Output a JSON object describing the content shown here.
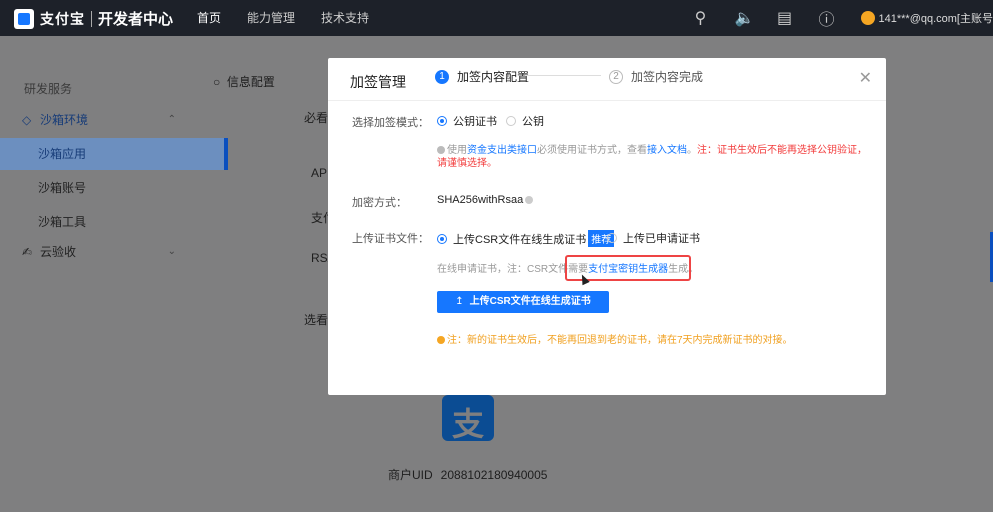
{
  "topbar": {
    "logo_brand": "支付宝",
    "logo_sub": "开发者中心",
    "nav": [
      "首页",
      "能力管理",
      "技术支持"
    ],
    "account": "141***@qq.com[主账号"
  },
  "sidebar": {
    "section": "研发服务",
    "items": [
      {
        "label": "沙箱环境",
        "icon": "cube-icon"
      },
      {
        "label": "沙箱应用"
      },
      {
        "label": "沙箱账号"
      },
      {
        "label": "沙箱工具"
      },
      {
        "label": "云验收",
        "icon": "check-doc-icon"
      }
    ]
  },
  "background": {
    "tab": "信息配置",
    "frag_required": "必看",
    "frag_api": "API",
    "frag_pay": "支付",
    "frag_rsa": "RSA",
    "frag_optional": "选看",
    "uid_label": "商户UID",
    "uid_value": "2088102180940005"
  },
  "modal": {
    "title": "加签管理",
    "steps": [
      {
        "num": "1",
        "label": "加签内容配置"
      },
      {
        "num": "2",
        "label": "加签内容完成"
      }
    ],
    "mode_label": "选择加签模式：",
    "mode_options": [
      "公钥证书",
      "公钥"
    ],
    "mode_hint_prefix": "使用",
    "mode_hint_link1": "资金支出类接口",
    "mode_hint_mid": "必须使用证书方式，查看",
    "mode_hint_link2": "接入文档",
    "mode_hint_dot": "。",
    "mode_hint_warn": "注：证书生效后不能再选择公钥验证，请谨慎选择。",
    "encrypt_label": "加密方式：",
    "encrypt_value": "SHA256withRsaa",
    "upload_label": "上传证书文件：",
    "upload_options": [
      "上传CSR文件在线生成证书",
      "上传已申请证书"
    ],
    "recommend_badge": "推荐",
    "csr_hint_prefix": "在线申请证书，注：CSR文件需要",
    "csr_hint_link": "支付宝密钥生成器",
    "csr_hint_suffix": "生成。",
    "upload_button": "上传CSR文件在线生成证书",
    "notice": "注：新的证书生效后，不能再回退到老的证书，请在7天内完成新证书的对接。"
  }
}
